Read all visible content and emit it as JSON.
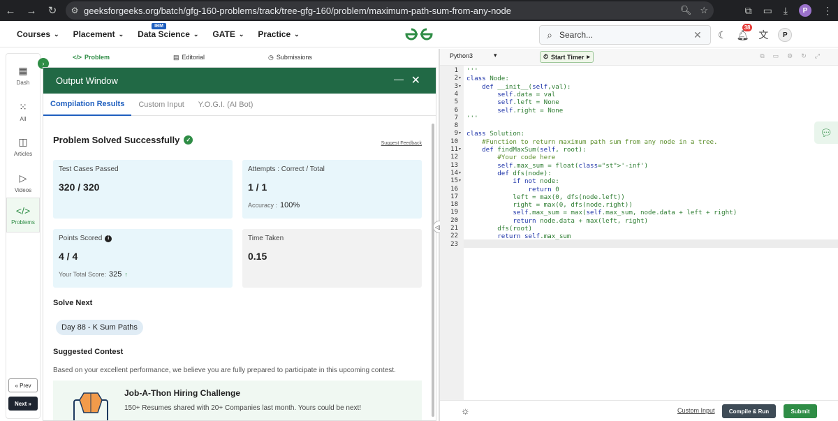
{
  "browser": {
    "url": "geeksforgeeks.org/batch/gfg-160-problems/track/tree-gfg-160/problem/maximum-path-sum-from-any-node",
    "profile_initial": "P"
  },
  "header": {
    "menu": [
      {
        "label": "Courses"
      },
      {
        "label": "Placement"
      },
      {
        "label": "Data Science",
        "badge": "IBM"
      },
      {
        "label": "GATE"
      },
      {
        "label": "Practice"
      }
    ],
    "search_placeholder": "Search...",
    "notification_count": "38",
    "user_initial": "P"
  },
  "sidebar": {
    "items": [
      {
        "label": "Dash",
        "icon": "dashboard-icon"
      },
      {
        "label": "All",
        "icon": "grid-icon"
      },
      {
        "label": "Articles",
        "icon": "book-icon"
      },
      {
        "label": "Videos",
        "icon": "video-icon"
      },
      {
        "label": "Problems",
        "icon": "code-icon"
      }
    ],
    "prev_label": "Prev",
    "next_label": "Next"
  },
  "problem_tabs": {
    "problem": "Problem",
    "editorial": "Editorial",
    "submissions": "Submissions"
  },
  "output_window": {
    "title": "Output Window",
    "tabs": [
      "Compilation Results",
      "Custom Input",
      "Y.O.G.I. (AI Bot)"
    ],
    "status": "Problem Solved Successfully",
    "suggest_feedback": "Suggest Feedback",
    "test_cases": {
      "label": "Test Cases Passed",
      "value": "320 / 320"
    },
    "attempts": {
      "label": "Attempts : Correct / Total",
      "value": "1 / 1",
      "accuracy_label": "Accuracy :",
      "accuracy_value": "100%"
    },
    "points": {
      "label": "Points Scored",
      "value": "4 / 4",
      "total_label": "Your Total Score:",
      "total_value": "325"
    },
    "time": {
      "label": "Time Taken",
      "value": "0.15"
    },
    "solve_next_title": "Solve Next",
    "solve_next_chip": "Day 88 - K Sum Paths",
    "contest_title": "Suggested Contest",
    "contest_desc": "Based on your excellent performance, we believe you are fully prepared to participate in this upcoming contest.",
    "contest_name": "Job-A-Thon Hiring Challenge",
    "contest_sub": "150+ Resumes shared with 20+ Companies last month. Yours could be next!"
  },
  "editor": {
    "language": "Python3",
    "timer_label": "Start Timer",
    "code_lines": [
      "'''",
      "class Node:",
      "    def __init__(self,val):",
      "        self.data = val",
      "        self.left = None",
      "        self.right = None",
      "'''",
      "",
      "class Solution:",
      "    #Function to return maximum path sum from any node in a tree.",
      "    def findMaxSum(self, root):",
      "        #Your code here",
      "        self.max_sum = float('-inf')",
      "        def dfs(node):",
      "            if not node:",
      "                return 0",
      "            left = max(0, dfs(node.left))",
      "            right = max(0, dfs(node.right))",
      "            self.max_sum = max(self.max_sum, node.data + left + right)",
      "            return node.data + max(left, right)",
      "        dfs(root)",
      "        return self.max_sum",
      ""
    ],
    "custom_input_label": "Custom Input",
    "compile_label": "Compile & Run",
    "submit_label": "Submit"
  }
}
